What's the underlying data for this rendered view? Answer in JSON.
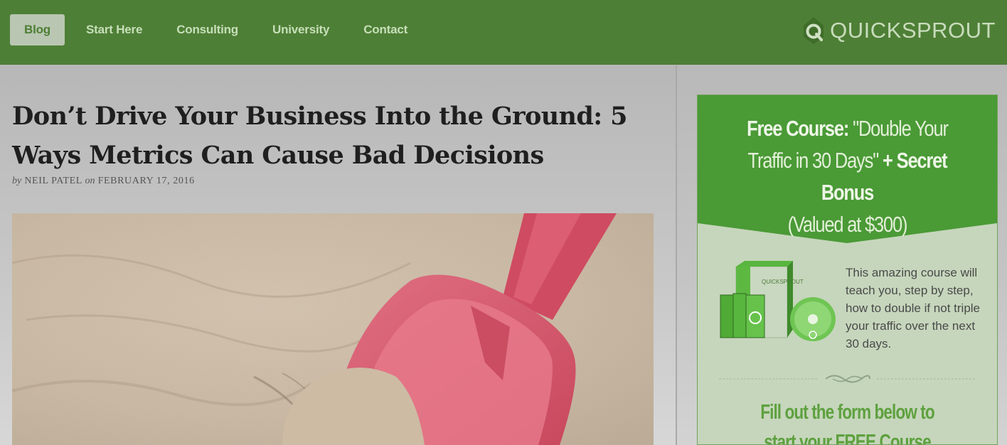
{
  "nav": {
    "items": [
      {
        "label": "Blog",
        "active": true
      },
      {
        "label": "Start Here",
        "active": false
      },
      {
        "label": "Consulting",
        "active": false
      },
      {
        "label": "University",
        "active": false
      },
      {
        "label": "Contact",
        "active": false
      }
    ]
  },
  "brand": {
    "name": "QUICKSPROUT"
  },
  "post": {
    "title": "Don’t Drive Your Business Into the Ground: 5 Ways Metrics Can Cause Bad Decisions",
    "by_prefix": "by",
    "author": "NEIL PATEL",
    "on_prefix": "on",
    "date": "FEBRUARY 17, 2016"
  },
  "sidebar": {
    "free_course_label": "Free Course:",
    "course_title": "\"Double Your Traffic in 30 Days\"",
    "bonus": "+ Secret Bonus",
    "valued": "(Valued at $300)",
    "box_brand": "QUICKSPROUT",
    "description": "This amazing course will teach you, step by step, how to double if not triple your traffic over the next 30 days.",
    "cta_line1": "Fill out the form below to",
    "cta_line2": "start your FREE Course"
  },
  "colors": {
    "header_green": "#4e7f36",
    "optin_green": "#4a9a36",
    "shovel_red": "#d24e63"
  }
}
